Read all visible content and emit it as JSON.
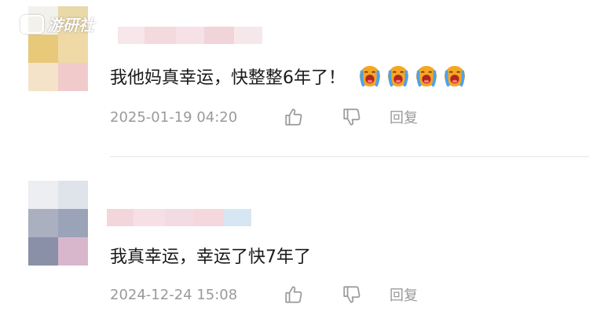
{
  "watermark": {
    "text": "游研社"
  },
  "comments": [
    {
      "text": "我他妈真幸运，快整整6年了！",
      "emoji_name": "crying-face-icon",
      "emoji_count": 4,
      "timestamp": "2025-01-19 04:20",
      "reply_label": "回复",
      "avatar_colors": [
        "#f3f1ec",
        "#e9d8a8",
        "#e8c97a",
        "#efd9a6",
        "#f4e3c9",
        "#f1cbcb"
      ],
      "username_colors": [
        "#f7e6ea",
        "#f4d9de",
        "#f6e2e6",
        "#f0d4da",
        "#f6e8ea"
      ]
    },
    {
      "text": "我真幸运，幸运了快7年了",
      "timestamp": "2024-12-24 15:08",
      "reply_label": "回复",
      "avatar_colors": [
        "#eceef2",
        "#dfe3ea",
        "#aab0c0",
        "#9aa3b8",
        "#8a90a8",
        "#d8b6cc"
      ],
      "username_colors": [
        "#f3d6dc",
        "#f6e0e6",
        "#f2dbe2",
        "#f4d8de",
        "#d6e6f2"
      ]
    }
  ],
  "colors": {
    "text": "#1a1a1a",
    "meta": "#9a9a9a",
    "divider": "#e6e6e6"
  }
}
